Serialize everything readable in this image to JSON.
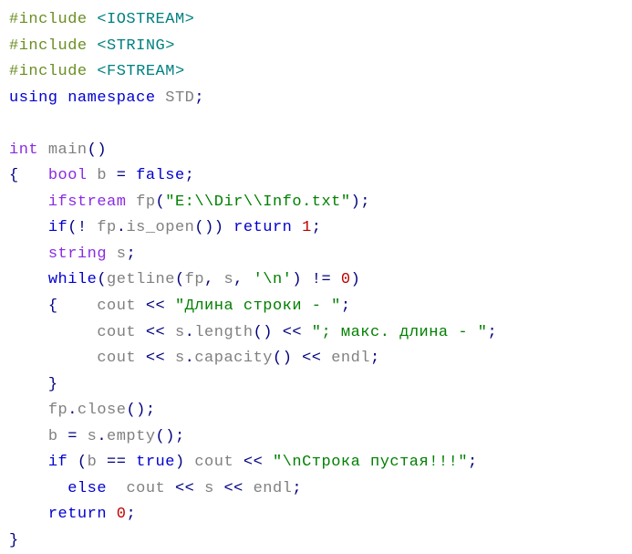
{
  "tok": {
    "hash": "#",
    "include": "include",
    "inc_io": "<IOSTREAM>",
    "inc_str": "<STRING>",
    "inc_fs": "<FSTREAM>",
    "using": "using",
    "namespace": "namespace",
    "std": "STD",
    "semi": ";",
    "int": "int",
    "main": "main",
    "lpar": "(",
    "rpar": ")",
    "lbrace": "{",
    "rbrace": "}",
    "bool": "bool",
    "b": "b",
    "eq": "=",
    "false_": "false",
    "true_": "true",
    "ifstream": "ifstream",
    "fp": "fp",
    "path": "\"E:\\\\Dir\\\\Info.txt\"",
    "if_": "if",
    "bang": "!",
    "dot": ".",
    "is_open": "is_open",
    "return_": "return",
    "one": "1",
    "zero": "0",
    "string_t": "string",
    "s": "s",
    "while_": "while",
    "getline": "getline",
    "comma": ",",
    "nl_char": "'\\n'",
    "neq": "!=",
    "cout": "cout",
    "lshift": "<<",
    "str_len": "\"Длина строки - \"",
    "length": "length",
    "str_max": "\"; макс. длинa - \"",
    "capacity": "capacity",
    "endl": "endl",
    "close": "close",
    "empty": "empty",
    "eqeq": "==",
    "str_empty": "\"\\nСтрока пустая!!!\"",
    "else_": "else"
  }
}
